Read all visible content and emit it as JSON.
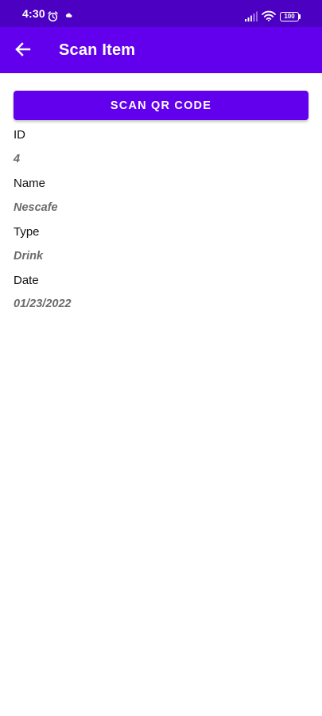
{
  "status_bar": {
    "time": "4:30",
    "battery": "100",
    "icons": [
      "alarm-icon",
      "cloud-icon",
      "signal-icon",
      "wifi-icon",
      "battery-icon"
    ]
  },
  "app_bar": {
    "title": "Scan Item",
    "back_icon": "arrow-left-icon"
  },
  "scan_button": {
    "label": "SCAN QR CODE"
  },
  "fields": [
    {
      "label": "ID",
      "value": "4"
    },
    {
      "label": "Name",
      "value": "Nescafe"
    },
    {
      "label": "Type",
      "value": "Drink"
    },
    {
      "label": "Date",
      "value": "01/23/2022"
    }
  ],
  "colors": {
    "status_bar": "#4c00c2",
    "primary": "#6200ee",
    "value_text": "#6b6b6b"
  }
}
